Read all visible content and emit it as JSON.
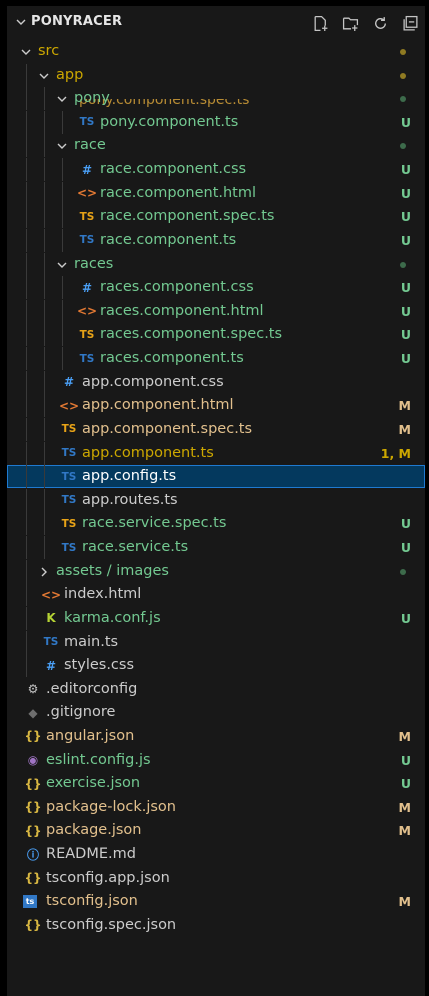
{
  "header": {
    "title": "PONYRACER",
    "actions": [
      "new-file-icon",
      "new-folder-icon",
      "refresh-icon",
      "collapse-all-icon"
    ]
  },
  "partial_item": "pony.component.spec.ts",
  "tree": [
    {
      "type": "folder",
      "label": "src",
      "depth": 0,
      "open": true,
      "color": "#cca700",
      "dot": "#8f7a22"
    },
    {
      "type": "folder",
      "label": "app",
      "depth": 1,
      "open": true,
      "color": "#cca700",
      "dot": "#8f7a22"
    },
    {
      "type": "folder",
      "label": "pony",
      "depth": 2,
      "open": true,
      "color": "#73c991",
      "dot": "#3d6b4b",
      "sticky": true
    },
    {
      "type": "file",
      "icon": "TS",
      "iconColor": "#3178c6",
      "label": "pony.component.ts",
      "depth": 3,
      "color": "#73c991",
      "status": "U"
    },
    {
      "type": "folder",
      "label": "race",
      "depth": 2,
      "open": true,
      "color": "#73c991",
      "dot": "#3d6b4b"
    },
    {
      "type": "file",
      "icon": "#",
      "iconColor": "#4a9ff5",
      "label": "race.component.css",
      "depth": 3,
      "color": "#73c991",
      "status": "U"
    },
    {
      "type": "file",
      "icon": "<>",
      "iconColor": "#e37933",
      "label": "race.component.html",
      "depth": 3,
      "color": "#73c991",
      "status": "U"
    },
    {
      "type": "file",
      "icon": "TS",
      "iconColor": "#e8a317",
      "label": "race.component.spec.ts",
      "depth": 3,
      "color": "#73c991",
      "status": "U"
    },
    {
      "type": "file",
      "icon": "TS",
      "iconColor": "#3178c6",
      "label": "race.component.ts",
      "depth": 3,
      "color": "#73c991",
      "status": "U"
    },
    {
      "type": "folder",
      "label": "races",
      "depth": 2,
      "open": true,
      "color": "#73c991",
      "dot": "#3d6b4b"
    },
    {
      "type": "file",
      "icon": "#",
      "iconColor": "#4a9ff5",
      "label": "races.component.css",
      "depth": 3,
      "color": "#73c991",
      "status": "U"
    },
    {
      "type": "file",
      "icon": "<>",
      "iconColor": "#e37933",
      "label": "races.component.html",
      "depth": 3,
      "color": "#73c991",
      "status": "U"
    },
    {
      "type": "file",
      "icon": "TS",
      "iconColor": "#e8a317",
      "label": "races.component.spec.ts",
      "depth": 3,
      "color": "#73c991",
      "status": "U"
    },
    {
      "type": "file",
      "icon": "TS",
      "iconColor": "#3178c6",
      "label": "races.component.ts",
      "depth": 3,
      "color": "#73c991",
      "status": "U"
    },
    {
      "type": "file",
      "icon": "#",
      "iconColor": "#4a9ff5",
      "label": "app.component.css",
      "depth": 2,
      "color": "#cccccc",
      "status": ""
    },
    {
      "type": "file",
      "icon": "<>",
      "iconColor": "#e37933",
      "label": "app.component.html",
      "depth": 2,
      "color": "#e2c08d",
      "status": "M"
    },
    {
      "type": "file",
      "icon": "TS",
      "iconColor": "#e8a317",
      "label": "app.component.spec.ts",
      "depth": 2,
      "color": "#e2c08d",
      "status": "M"
    },
    {
      "type": "file",
      "icon": "TS",
      "iconColor": "#3178c6",
      "label": "app.component.ts",
      "depth": 2,
      "color": "#cca700",
      "status": "1, M"
    },
    {
      "type": "file",
      "icon": "TS",
      "iconColor": "#3178c6",
      "label": "app.config.ts",
      "depth": 2,
      "color": "#ffffff",
      "status": "",
      "selected": true
    },
    {
      "type": "file",
      "icon": "TS",
      "iconColor": "#3178c6",
      "label": "app.routes.ts",
      "depth": 2,
      "color": "#cccccc",
      "status": ""
    },
    {
      "type": "file",
      "icon": "TS",
      "iconColor": "#e8a317",
      "label": "race.service.spec.ts",
      "depth": 2,
      "color": "#73c991",
      "status": "U"
    },
    {
      "type": "file",
      "icon": "TS",
      "iconColor": "#3178c6",
      "label": "race.service.ts",
      "depth": 2,
      "color": "#73c991",
      "status": "U"
    },
    {
      "type": "folder",
      "label": "assets / images",
      "depth": 1,
      "open": false,
      "color": "#73c991",
      "dot": "#3d6b4b"
    },
    {
      "type": "file",
      "icon": "<>",
      "iconColor": "#e37933",
      "label": "index.html",
      "depth": 1,
      "color": "#cccccc",
      "status": ""
    },
    {
      "type": "file",
      "icon": "K",
      "iconColor": "#b5d334",
      "label": "karma.conf.js",
      "depth": 1,
      "color": "#73c991",
      "status": "U"
    },
    {
      "type": "file",
      "icon": "TS",
      "iconColor": "#3178c6",
      "label": "main.ts",
      "depth": 1,
      "color": "#cccccc",
      "status": ""
    },
    {
      "type": "file",
      "icon": "#",
      "iconColor": "#4a9ff5",
      "label": "styles.css",
      "depth": 1,
      "color": "#cccccc",
      "status": ""
    },
    {
      "type": "file",
      "icon": "⚙",
      "iconColor": "#c5c5c5",
      "label": ".editorconfig",
      "depth": 0,
      "color": "#cccccc",
      "status": ""
    },
    {
      "type": "file",
      "icon": "◆",
      "iconColor": "#6e6e6e",
      "label": ".gitignore",
      "depth": 0,
      "color": "#cccccc",
      "status": ""
    },
    {
      "type": "file",
      "icon": "{}",
      "iconColor": "#d8b742",
      "label": "angular.json",
      "depth": 0,
      "color": "#e2c08d",
      "status": "M"
    },
    {
      "type": "file",
      "icon": "◉",
      "iconColor": "#a074c4",
      "label": "eslint.config.js",
      "depth": 0,
      "color": "#73c991",
      "status": "U"
    },
    {
      "type": "file",
      "icon": "{}",
      "iconColor": "#d8b742",
      "label": "exercise.json",
      "depth": 0,
      "color": "#73c991",
      "status": "U"
    },
    {
      "type": "file",
      "icon": "{}",
      "iconColor": "#d8b742",
      "label": "package-lock.json",
      "depth": 0,
      "color": "#e2c08d",
      "status": "M"
    },
    {
      "type": "file",
      "icon": "{}",
      "iconColor": "#d8b742",
      "label": "package.json",
      "depth": 0,
      "color": "#e2c08d",
      "status": "M"
    },
    {
      "type": "file",
      "icon": "ⓘ",
      "iconColor": "#4a9ff5",
      "label": "README.md",
      "depth": 0,
      "color": "#cccccc",
      "status": ""
    },
    {
      "type": "file",
      "icon": "{}",
      "iconColor": "#d8b742",
      "label": "tsconfig.app.json",
      "depth": 0,
      "color": "#cccccc",
      "status": ""
    },
    {
      "type": "file",
      "icon": "ts",
      "iconColor": "#3178c6",
      "label": "tsconfig.json",
      "depth": 0,
      "color": "#e2c08d",
      "status": "M",
      "boxed": true
    },
    {
      "type": "file",
      "icon": "{}",
      "iconColor": "#d8b742",
      "label": "tsconfig.spec.json",
      "depth": 0,
      "color": "#cccccc",
      "status": ""
    }
  ]
}
